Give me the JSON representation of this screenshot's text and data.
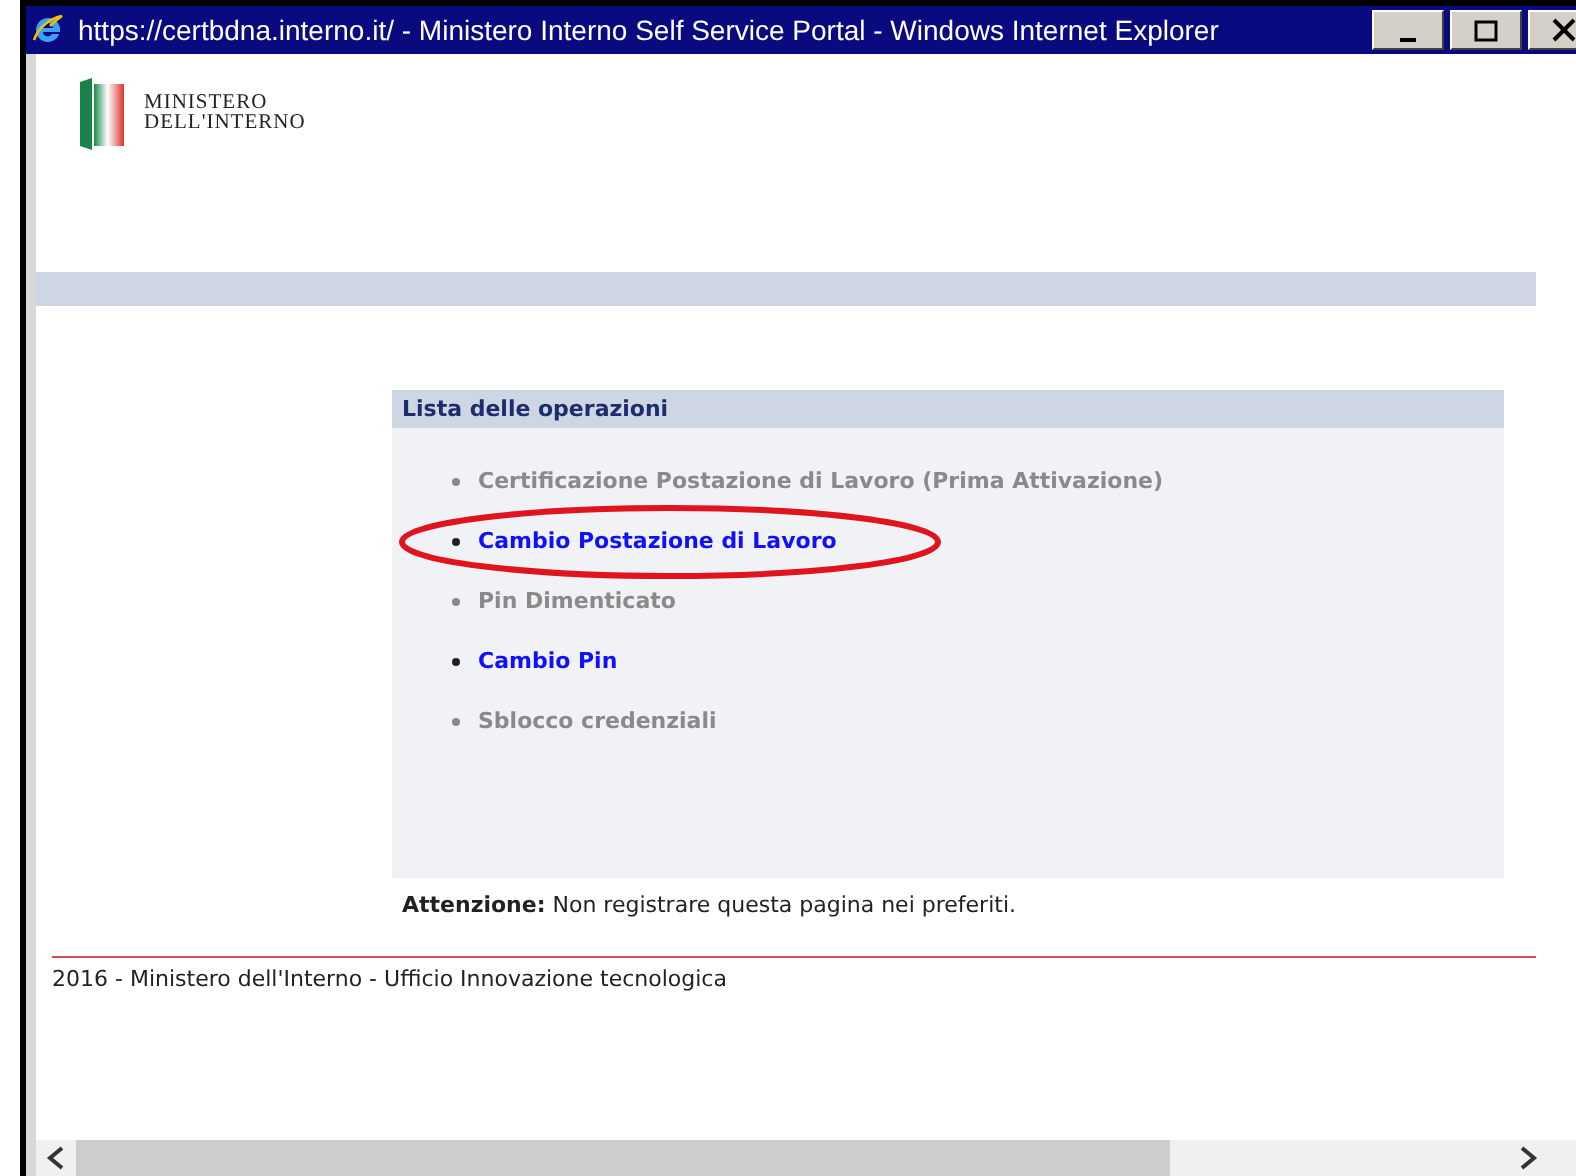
{
  "window": {
    "title": "https://certbdna.interno.it/ - Ministero Interno Self Service Portal - Windows Internet Explorer"
  },
  "logo": {
    "line_1": "MINISTERO",
    "line_2": "DELL'INTERNO"
  },
  "panel": {
    "title": "Lista delle operazioni",
    "items": [
      {
        "label": "Certificazione Postazione di Lavoro (Prima Attivazione)",
        "disabled": true,
        "circled": false
      },
      {
        "label": "Cambio Postazione di Lavoro",
        "disabled": false,
        "circled": true
      },
      {
        "label": "Pin Dimenticato",
        "disabled": true,
        "circled": false
      },
      {
        "label": "Cambio Pin",
        "disabled": false,
        "circled": false
      },
      {
        "label": "Sblocco credenziali",
        "disabled": true,
        "circled": false
      }
    ]
  },
  "notice": "**Attenzione:** Non registrare questa pagina nei preferiti.",
  "footer": "2016 - Ministero dell'Interno - Ufficio Innovazione tecnologica"
}
